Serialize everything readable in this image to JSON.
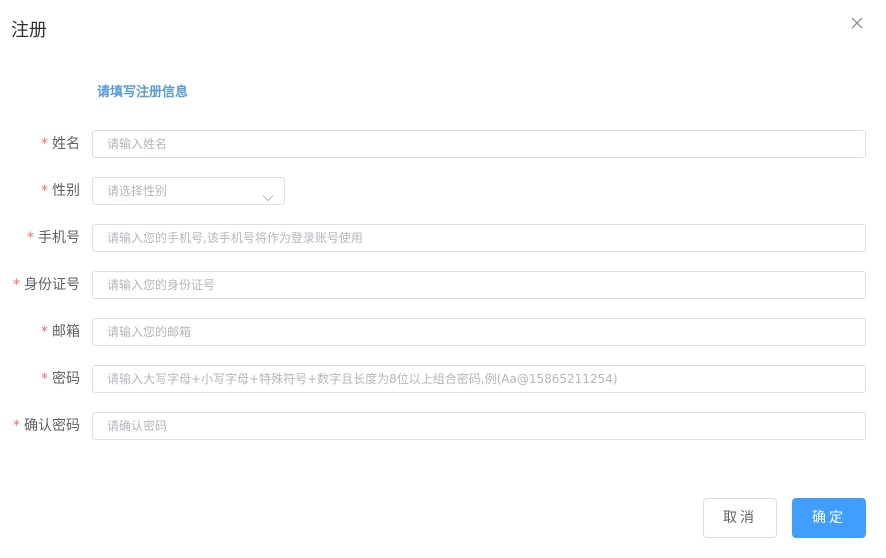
{
  "dialog": {
    "title": "注册",
    "subtitle": "请填写注册信息"
  },
  "form": {
    "required_mark": "*",
    "name": {
      "label": "姓名",
      "placeholder": "请输入姓名"
    },
    "gender": {
      "label": "性别",
      "placeholder": "请选择性别"
    },
    "phone": {
      "label": "手机号",
      "placeholder": "请输入您的手机号,该手机号将作为登录账号使用"
    },
    "id_card": {
      "label": "身份证号",
      "placeholder": "请输入您的身份证号"
    },
    "email": {
      "label": "邮箱",
      "placeholder": "请输入您的邮箱"
    },
    "password": {
      "label": "密码",
      "placeholder": "请输入大写字母+小写字母+特殊符号+数字且长度为8位以上组合密码,例(Aa@15865211254)"
    },
    "confirm_password": {
      "label": "确认密码",
      "placeholder": "请确认密码"
    }
  },
  "footer": {
    "cancel_label": "取消",
    "confirm_label": "确定"
  },
  "icons": {
    "close": "close-icon",
    "chevron": "chevron-down-icon"
  },
  "colors": {
    "primary": "#409eff",
    "required": "#f56c6c",
    "subtitle": "#5a9bd4"
  }
}
